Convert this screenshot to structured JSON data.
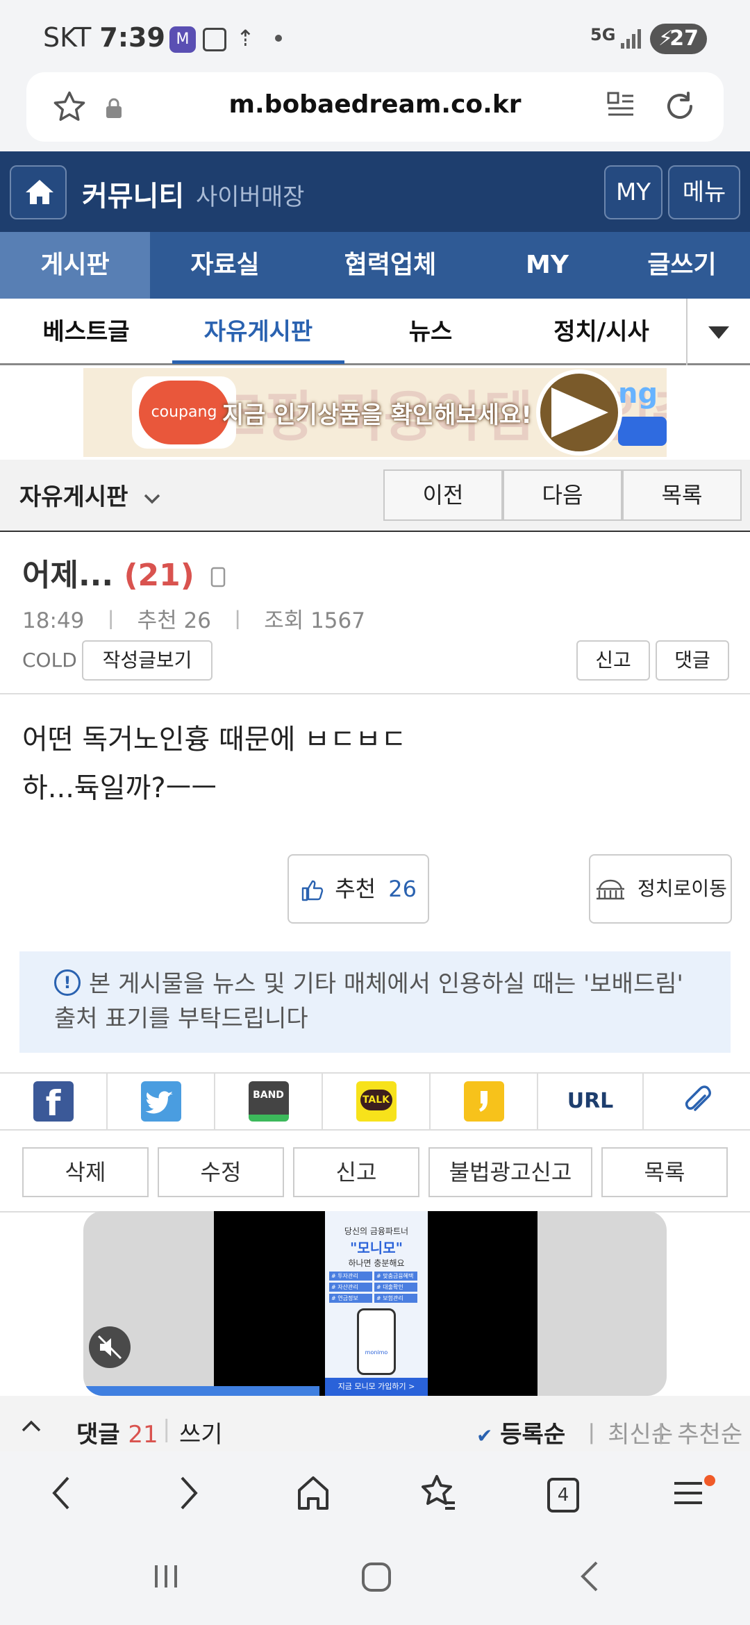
{
  "status_bar": {
    "carrier": "SKT",
    "time": "7:39",
    "network": "5G",
    "battery": "27"
  },
  "browser": {
    "url": "m.bobaedream.co.kr",
    "tab_count": "4"
  },
  "header": {
    "title": "커뮤니티",
    "subtitle": "사이버매장",
    "my_label": "MY",
    "menu_label": "메뉴"
  },
  "main_nav": {
    "items": [
      "게시판",
      "자료실",
      "협력업체",
      "MY",
      "글쓰기"
    ]
  },
  "sub_nav": {
    "items": [
      "베스트글",
      "자유게시판",
      "뉴스",
      "정치/시사"
    ],
    "active_index": 1
  },
  "ad_banner": {
    "brand": "coupang",
    "text": "지금 인기상품을 확인해보세요!",
    "bg_text": "크팡 미용아템 세일중",
    "right_text": "ng"
  },
  "board": {
    "title": "자유게시판",
    "prev_label": "이전",
    "next_label": "다음",
    "list_label": "목록"
  },
  "post": {
    "title": "어제...",
    "comment_count": "(21)",
    "time": "18:49",
    "recommend": "추천 26",
    "views": "조회 1567",
    "author": "COLD",
    "view_posts_label": "작성글보기",
    "report_label": "신고",
    "comment_label": "댓글",
    "body_lines": [
      "어떤 독거노인흉 때문에 ㅂㄷㅂㄷ",
      "하...듁일까?ㅡㅡ"
    ]
  },
  "vote": {
    "recommend_label": "추천",
    "recommend_count": "26",
    "politics_label": "정치로이동"
  },
  "notice": {
    "text": "본 게시물을 뉴스 및 기타 매체에서 인용하실 때는 '보배드림' 출처 표기를 부탁드립니다"
  },
  "share": {
    "url_label": "URL",
    "band_label": "BAND",
    "talk_label": "TALK"
  },
  "actions": {
    "items": [
      "삭제",
      "수정",
      "신고",
      "불법광고신고",
      "목록"
    ]
  },
  "video_ad": {
    "line1": "당신의 금융파트너",
    "line2": "\"모니모\"",
    "line3": "하나면 충분해요",
    "tags": [
      "# 투자관리",
      "# 맞춤금융혜택",
      "# 자산관리",
      "# 대출확인",
      "# 연금정보",
      "# 보험관리"
    ],
    "brand": "monimo",
    "cta": "지금 모니모 가입하기 >"
  },
  "comments": {
    "label": "댓글",
    "count": "21",
    "write_label": "쓰기",
    "sort_registered": "등록순",
    "sort_latest": "최신순",
    "sort_recommend": "추천순"
  },
  "colors": {
    "header": "#1e3e6e",
    "main_nav": "#2f5a95",
    "accent_red": "#d9534f",
    "accent_blue": "#2a62b0"
  }
}
